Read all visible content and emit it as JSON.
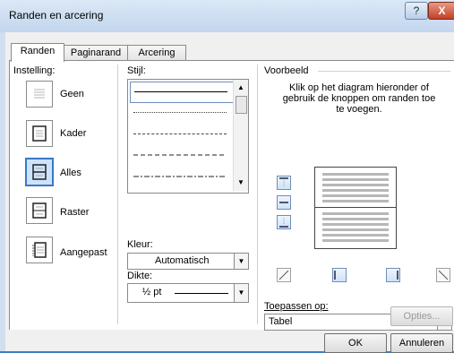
{
  "window": {
    "title": "Randen en arcering",
    "help_label": "?",
    "close_label": "X"
  },
  "tabs": [
    {
      "label": "Randen",
      "active": true
    },
    {
      "label": "Paginarand",
      "active": false
    },
    {
      "label": "Arcering",
      "active": false
    }
  ],
  "instelling": {
    "heading": "Instelling:",
    "items": [
      {
        "label": "Geen",
        "icon": "setting-none-icon",
        "selected": false
      },
      {
        "label": "Kader",
        "icon": "setting-box-icon",
        "selected": false
      },
      {
        "label": "Alles",
        "icon": "setting-all-icon",
        "selected": true
      },
      {
        "label": "Raster",
        "icon": "setting-grid-icon",
        "selected": false
      },
      {
        "label": "Aangepast",
        "icon": "setting-custom-icon",
        "selected": false
      }
    ]
  },
  "stijl": {
    "heading": "Stijl:",
    "styles": [
      "solid",
      "dotted",
      "dashed-small",
      "dashed",
      "dash-dot"
    ],
    "selected_index": 0
  },
  "kleur": {
    "label": "Kleur:",
    "value": "Automatisch"
  },
  "dikte": {
    "label": "Dikte:",
    "value": "½ pt"
  },
  "voorbeeld": {
    "heading": "Voorbeeld",
    "instruction": "Klik op het diagram hieronder of gebruik de knoppen om randen toe te voegen."
  },
  "toepassen": {
    "label": "Toepassen op:",
    "value": "Tabel"
  },
  "buttons": {
    "options": "Opties...",
    "ok": "OK",
    "cancel": "Annuleren"
  }
}
